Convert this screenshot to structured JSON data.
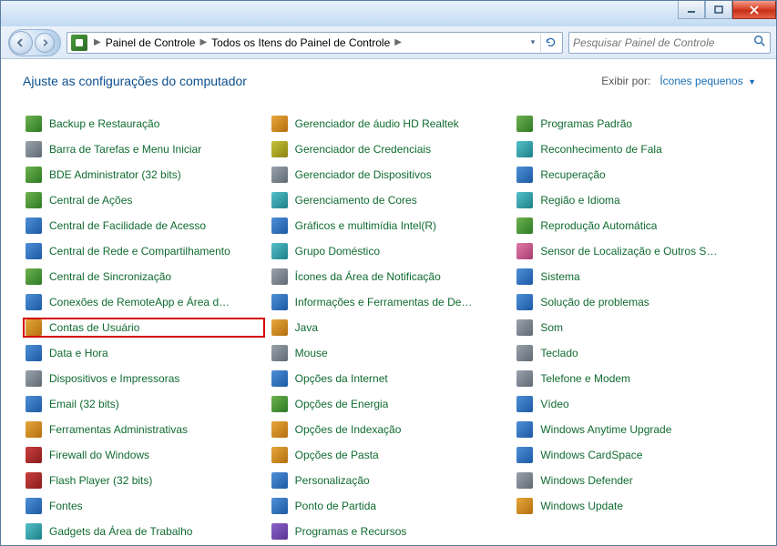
{
  "window": {
    "minimize_tip": "Minimize",
    "maximize_tip": "Maximize",
    "close_tip": "Close"
  },
  "breadcrumb": {
    "root": "Painel de Controle",
    "sub": "Todos os Itens do Painel de Controle"
  },
  "search": {
    "placeholder": "Pesquisar Painel de Controle"
  },
  "header": {
    "title": "Ajuste as configurações do computador",
    "view_by_label": "Exibir por:",
    "view_by_value": "Ícones pequenos"
  },
  "items": [
    {
      "label": "Backup e Restauração",
      "icon": "backup-icon",
      "c": "c1"
    },
    {
      "label": "Barra de Tarefas e Menu Iniciar",
      "icon": "taskbar-icon",
      "c": "c7"
    },
    {
      "label": "BDE Administrator (32 bits)",
      "icon": "bde-icon",
      "c": "c1"
    },
    {
      "label": "Central de Ações",
      "icon": "action-center-icon",
      "c": "c1"
    },
    {
      "label": "Central de Facilidade de Acesso",
      "icon": "ease-access-icon",
      "c": "c2"
    },
    {
      "label": "Central de Rede e Compartilhamento",
      "icon": "network-icon",
      "c": "c2"
    },
    {
      "label": "Central de Sincronização",
      "icon": "sync-icon",
      "c": "c1"
    },
    {
      "label": "Conexões de RemoteApp e Área de ...",
      "icon": "remoteapp-icon",
      "c": "c2"
    },
    {
      "label": "Contas de Usuário",
      "icon": "user-accounts-icon",
      "c": "c3",
      "hl": true
    },
    {
      "label": "Data e Hora",
      "icon": "date-time-icon",
      "c": "c2"
    },
    {
      "label": "Dispositivos e Impressoras",
      "icon": "devices-printers-icon",
      "c": "c7"
    },
    {
      "label": "Email (32 bits)",
      "icon": "email-icon",
      "c": "c2"
    },
    {
      "label": "Ferramentas Administrativas",
      "icon": "admin-tools-icon",
      "c": "c3"
    },
    {
      "label": "Firewall do Windows",
      "icon": "firewall-icon",
      "c": "c4"
    },
    {
      "label": "Flash Player (32 bits)",
      "icon": "flash-icon",
      "c": "c4"
    },
    {
      "label": "Fontes",
      "icon": "fonts-icon",
      "c": "c2"
    },
    {
      "label": "Gadgets da Área de Trabalho",
      "icon": "gadgets-icon",
      "c": "c6"
    },
    {
      "label": "Gerenciador de áudio HD Realtek",
      "icon": "realtek-icon",
      "c": "c3"
    },
    {
      "label": "Gerenciador de Credenciais",
      "icon": "credentials-icon",
      "c": "c9"
    },
    {
      "label": "Gerenciador de Dispositivos",
      "icon": "device-manager-icon",
      "c": "c7"
    },
    {
      "label": "Gerenciamento de Cores",
      "icon": "color-mgmt-icon",
      "c": "c6"
    },
    {
      "label": "Gráficos e multimídia Intel(R)",
      "icon": "intel-gfx-icon",
      "c": "c2"
    },
    {
      "label": "Grupo Doméstico",
      "icon": "homegroup-icon",
      "c": "c6"
    },
    {
      "label": "Ícones da Área de Notificação",
      "icon": "notification-icons-icon",
      "c": "c7"
    },
    {
      "label": "Informações e Ferramentas de Dese...",
      "icon": "perf-info-icon",
      "c": "c2"
    },
    {
      "label": "Java",
      "icon": "java-icon",
      "c": "c3"
    },
    {
      "label": "Mouse",
      "icon": "mouse-icon",
      "c": "c7"
    },
    {
      "label": "Opções da Internet",
      "icon": "internet-options-icon",
      "c": "c2"
    },
    {
      "label": "Opções de Energia",
      "icon": "power-options-icon",
      "c": "c1"
    },
    {
      "label": "Opções de Indexação",
      "icon": "indexing-icon",
      "c": "c3"
    },
    {
      "label": "Opções de Pasta",
      "icon": "folder-options-icon",
      "c": "c3"
    },
    {
      "label": "Personalização",
      "icon": "personalization-icon",
      "c": "c2"
    },
    {
      "label": "Ponto de Partida",
      "icon": "getting-started-icon",
      "c": "c2"
    },
    {
      "label": "Programas e Recursos",
      "icon": "programs-features-icon",
      "c": "c5"
    },
    {
      "label": "Programas Padrão",
      "icon": "default-programs-icon",
      "c": "c1"
    },
    {
      "label": "Reconhecimento de Fala",
      "icon": "speech-icon",
      "c": "c6"
    },
    {
      "label": "Recuperação",
      "icon": "recovery-icon",
      "c": "c2"
    },
    {
      "label": "Região e Idioma",
      "icon": "region-icon",
      "c": "c6"
    },
    {
      "label": "Reprodução Automática",
      "icon": "autoplay-icon",
      "c": "c1"
    },
    {
      "label": "Sensor de Localização e Outros Sens...",
      "icon": "sensors-icon",
      "c": "c8"
    },
    {
      "label": "Sistema",
      "icon": "system-icon",
      "c": "c2"
    },
    {
      "label": "Solução de problemas",
      "icon": "troubleshoot-icon",
      "c": "c2"
    },
    {
      "label": "Som",
      "icon": "sound-icon",
      "c": "c7"
    },
    {
      "label": "Teclado",
      "icon": "keyboard-icon",
      "c": "c7"
    },
    {
      "label": "Telefone e Modem",
      "icon": "phone-modem-icon",
      "c": "c7"
    },
    {
      "label": "Vídeo",
      "icon": "display-icon",
      "c": "c2"
    },
    {
      "label": "Windows Anytime Upgrade",
      "icon": "anytime-upgrade-icon",
      "c": "c2"
    },
    {
      "label": "Windows CardSpace",
      "icon": "cardspace-icon",
      "c": "c2"
    },
    {
      "label": "Windows Defender",
      "icon": "defender-icon",
      "c": "c7"
    },
    {
      "label": "Windows Update",
      "icon": "windows-update-icon",
      "c": "c3"
    }
  ]
}
